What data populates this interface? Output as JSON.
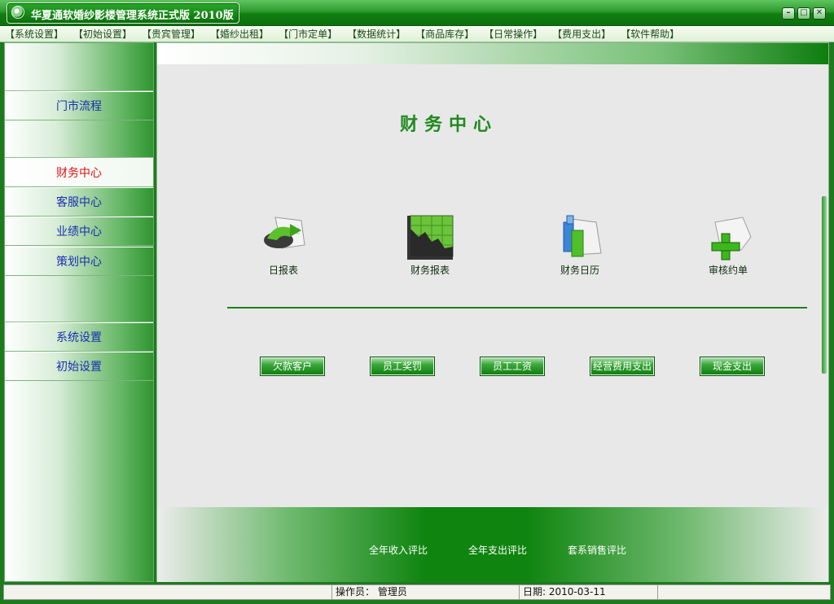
{
  "window": {
    "title": "华夏通软婚纱影楼管理系统正式版 2010版",
    "controls": {
      "minimize": "–",
      "maximize": "□",
      "close": "✕"
    }
  },
  "menu": {
    "items": [
      "【系统设置】",
      "【初始设置】",
      "【贵宾管理】",
      "【婚纱出租】",
      "【门市定单】",
      "【数据统计】",
      "【商品库存】",
      "【日常操作】",
      "【费用支出】",
      "【软件帮助】"
    ]
  },
  "sidebar": {
    "items": [
      {
        "label": "门市流程",
        "active": false
      },
      {
        "label": "财务中心",
        "active": true
      },
      {
        "label": "客服中心",
        "active": false
      },
      {
        "label": "业绩中心",
        "active": false
      },
      {
        "label": "策划中心",
        "active": false
      },
      {
        "label": "系统设置",
        "active": false
      },
      {
        "label": "初始设置",
        "active": false
      }
    ]
  },
  "main": {
    "title": "财务中心",
    "features": [
      {
        "label": "日报表",
        "icon": "daily-report-icon"
      },
      {
        "label": "财务报表",
        "icon": "financial-chart-icon"
      },
      {
        "label": "财务日历",
        "icon": "finance-calendar-icon"
      },
      {
        "label": "审核约单",
        "icon": "review-order-icon"
      }
    ],
    "buttons": [
      "欠款客户",
      "员工奖罚",
      "员工工资",
      "经营费用支出",
      "现金支出"
    ],
    "bottom_links": [
      "全年收入评比",
      "全年支出评比",
      "套系销售评比"
    ]
  },
  "status": {
    "operator_label": "操作员：",
    "operator_value": "管理员",
    "date_label": "日期:",
    "date_value": "2010-03-11"
  },
  "colors": {
    "brand_green": "#0f840f",
    "active_text": "#e01010",
    "link_text": "#1a2fb0"
  }
}
